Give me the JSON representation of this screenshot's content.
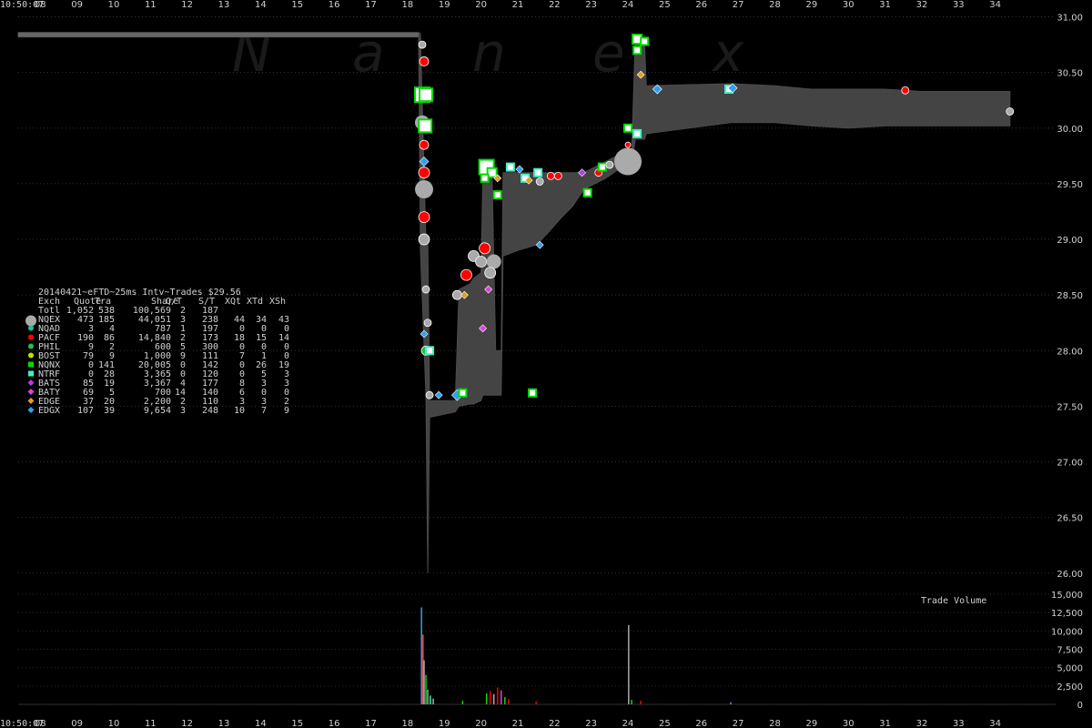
{
  "chart_data": {
    "type": "scatter",
    "watermark": [
      "N",
      "a",
      "n",
      "e",
      "x"
    ],
    "x_start_label": "10:50:07",
    "x_ticks": [
      "08",
      "09",
      "10",
      "11",
      "12",
      "13",
      "14",
      "15",
      "16",
      "17",
      "18",
      "19",
      "20",
      "21",
      "22",
      "23",
      "24",
      "25",
      "26",
      "27",
      "28",
      "29",
      "30",
      "31",
      "32",
      "33",
      "34"
    ],
    "x_range": [
      7.4,
      34.9
    ],
    "price_axis": {
      "range": [
        25.9,
        31.07
      ],
      "ticks": [
        "26.00",
        "26.50",
        "27.00",
        "27.50",
        "28.00",
        "28.50",
        "29.00",
        "29.50",
        "30.00",
        "30.50",
        "31.00"
      ]
    },
    "volume_axis": {
      "label": "Trade Volume",
      "range": [
        0,
        15000
      ],
      "ticks": [
        "0",
        "2,500",
        "5,000",
        "7,500",
        "10,000",
        "12,500",
        "15,000"
      ]
    },
    "table": {
      "title": "20140421~eFTD~25ms Intv~Trades $29.56",
      "columns": [
        "Exch",
        "Quote",
        "Tra",
        "Share",
        "Q/T",
        "S/T",
        "XQt",
        "XTd",
        "XSh"
      ],
      "total": [
        "Totl",
        "1,052",
        "538",
        "100,569",
        "2",
        "187",
        "",
        "",
        ""
      ],
      "rows": [
        {
          "cells": [
            "NQEX",
            "473",
            "185",
            "44,051",
            "3",
            "238",
            "44",
            "34",
            "43"
          ],
          "color": "#aaaaaa",
          "marker": "circle-big"
        },
        {
          "cells": [
            "NQAD",
            "3",
            "4",
            "787",
            "1",
            "197",
            "0",
            "0",
            "0"
          ],
          "color": "#20c0a0",
          "marker": "circle"
        },
        {
          "cells": [
            "PACF",
            "190",
            "86",
            "14,840",
            "2",
            "173",
            "18",
            "15",
            "14"
          ],
          "color": "#ff0000",
          "marker": "circle"
        },
        {
          "cells": [
            "PHIL",
            "9",
            "2",
            "600",
            "5",
            "300",
            "0",
            "0",
            "0"
          ],
          "color": "#20c040",
          "marker": "circle"
        },
        {
          "cells": [
            "BOST",
            "79",
            "9",
            "1,000",
            "9",
            "111",
            "7",
            "1",
            "0"
          ],
          "color": "#c0e000",
          "marker": "circle"
        },
        {
          "cells": [
            "NQNX",
            "0",
            "141",
            "20,005",
            "0",
            "142",
            "0",
            "26",
            "19"
          ],
          "color": "#00dd00",
          "marker": "square"
        },
        {
          "cells": [
            "NTRF",
            "0",
            "28",
            "3,365",
            "0",
            "120",
            "0",
            "5",
            "3"
          ],
          "color": "#40f0c0",
          "marker": "square"
        },
        {
          "cells": [
            "BATS",
            "85",
            "19",
            "3,367",
            "4",
            "177",
            "8",
            "3",
            "3"
          ],
          "color": "#b040e0",
          "marker": "diamond"
        },
        {
          "cells": [
            "BATY",
            "69",
            "5",
            "700",
            "14",
            "140",
            "6",
            "0",
            "0"
          ],
          "color": "#e040e0",
          "marker": "diamond"
        },
        {
          "cells": [
            "EDGE",
            "37",
            "20",
            "2,200",
            "2",
            "110",
            "3",
            "3",
            "2"
          ],
          "color": "#e0a020",
          "marker": "diamond"
        },
        {
          "cells": [
            "EDGX",
            "107",
            "39",
            "9,654",
            "3",
            "248",
            "10",
            "7",
            "9"
          ],
          "color": "#30a0f0",
          "marker": "diamond"
        }
      ]
    },
    "nbbo_band": [
      [
        7.4,
        30.86,
        30.82
      ],
      [
        18.3,
        30.86,
        30.82
      ],
      [
        18.35,
        30.85,
        28.9
      ],
      [
        18.5,
        29.0,
        27.6
      ],
      [
        18.55,
        29.0,
        26.0
      ],
      [
        18.6,
        27.55,
        27.4
      ],
      [
        19.3,
        27.55,
        27.45
      ],
      [
        19.4,
        28.55,
        27.5
      ],
      [
        19.7,
        28.6,
        27.52
      ],
      [
        19.8,
        28.65,
        27.52
      ],
      [
        20.0,
        28.7,
        27.55
      ],
      [
        20.05,
        29.55,
        27.6
      ],
      [
        20.3,
        29.6,
        27.6
      ],
      [
        20.4,
        28.0,
        27.6
      ],
      [
        20.55,
        28.0,
        27.6
      ],
      [
        20.6,
        29.6,
        28.85
      ],
      [
        21.0,
        29.6,
        28.9
      ],
      [
        21.5,
        29.6,
        28.95
      ],
      [
        21.8,
        29.6,
        29.05
      ],
      [
        22.2,
        29.6,
        29.2
      ],
      [
        22.5,
        29.6,
        29.3
      ],
      [
        22.8,
        29.6,
        29.45
      ],
      [
        23.1,
        29.65,
        29.5
      ],
      [
        23.4,
        29.7,
        29.55
      ],
      [
        23.7,
        29.75,
        29.62
      ],
      [
        24.1,
        29.78,
        29.66
      ],
      [
        24.2,
        30.8,
        29.9
      ],
      [
        24.45,
        30.8,
        29.9
      ],
      [
        24.5,
        30.38,
        29.95
      ],
      [
        26.8,
        30.4,
        30.05
      ],
      [
        28.0,
        30.38,
        30.05
      ],
      [
        29.0,
        30.35,
        30.02
      ],
      [
        30.0,
        30.35,
        30.0
      ],
      [
        31.0,
        30.35,
        30.02
      ],
      [
        32.0,
        30.33,
        30.02
      ],
      [
        33.0,
        30.33,
        30.02
      ],
      [
        34.4,
        30.33,
        30.02
      ]
    ],
    "trades": [
      {
        "x": 18.4,
        "y": 30.75,
        "ex": "NQEX",
        "s": 4
      },
      {
        "x": 18.45,
        "y": 30.6,
        "ex": "PACF",
        "s": 5
      },
      {
        "x": 18.4,
        "y": 30.3,
        "ex": "NQNX",
        "s": 8
      },
      {
        "x": 18.5,
        "y": 30.3,
        "ex": "NQNX",
        "s": 7
      },
      {
        "x": 18.4,
        "y": 30.05,
        "ex": "NQEX",
        "s": 8
      },
      {
        "x": 18.48,
        "y": 30.02,
        "ex": "NQNX",
        "s": 7
      },
      {
        "x": 18.45,
        "y": 29.85,
        "ex": "PACF",
        "s": 5
      },
      {
        "x": 18.45,
        "y": 29.7,
        "ex": "EDGX",
        "s": 5
      },
      {
        "x": 18.45,
        "y": 29.6,
        "ex": "PACF",
        "s": 6
      },
      {
        "x": 18.45,
        "y": 29.45,
        "ex": "NQEX",
        "s": 10
      },
      {
        "x": 18.45,
        "y": 29.2,
        "ex": "PACF",
        "s": 6
      },
      {
        "x": 18.45,
        "y": 29.0,
        "ex": "NQEX",
        "s": 6
      },
      {
        "x": 18.5,
        "y": 28.55,
        "ex": "NQEX",
        "s": 4
      },
      {
        "x": 18.55,
        "y": 28.25,
        "ex": "NQEX",
        "s": 4
      },
      {
        "x": 18.45,
        "y": 28.15,
        "ex": "EDGX",
        "s": 4
      },
      {
        "x": 18.5,
        "y": 28.0,
        "ex": "PHIL",
        "s": 5
      },
      {
        "x": 18.6,
        "y": 28.0,
        "ex": "NTRF",
        "s": 4
      },
      {
        "x": 18.6,
        "y": 27.6,
        "ex": "NQEX",
        "s": 4
      },
      {
        "x": 18.85,
        "y": 27.6,
        "ex": "EDGX",
        "s": 4
      },
      {
        "x": 19.35,
        "y": 27.6,
        "ex": "EDGX",
        "s": 6
      },
      {
        "x": 19.5,
        "y": 27.62,
        "ex": "NQNX",
        "s": 4
      },
      {
        "x": 19.35,
        "y": 28.5,
        "ex": "NQEX",
        "s": 5
      },
      {
        "x": 19.55,
        "y": 28.5,
        "ex": "EDGE",
        "s": 4
      },
      {
        "x": 19.6,
        "y": 28.68,
        "ex": "PACF",
        "s": 6
      },
      {
        "x": 19.8,
        "y": 28.85,
        "ex": "NQEX",
        "s": 6
      },
      {
        "x": 20.0,
        "y": 28.8,
        "ex": "NQEX",
        "s": 6
      },
      {
        "x": 20.1,
        "y": 28.92,
        "ex": "PACF",
        "s": 6
      },
      {
        "x": 20.35,
        "y": 28.8,
        "ex": "NQEX",
        "s": 8
      },
      {
        "x": 20.25,
        "y": 28.7,
        "ex": "NQEX",
        "s": 6
      },
      {
        "x": 20.05,
        "y": 28.2,
        "ex": "BATY",
        "s": 4
      },
      {
        "x": 20.15,
        "y": 29.65,
        "ex": "NQNX",
        "s": 8
      },
      {
        "x": 20.3,
        "y": 29.6,
        "ex": "NQNX",
        "s": 5
      },
      {
        "x": 20.45,
        "y": 29.55,
        "ex": "EDGE",
        "s": 4
      },
      {
        "x": 20.1,
        "y": 29.55,
        "ex": "NQNX",
        "s": 4
      },
      {
        "x": 20.8,
        "y": 29.65,
        "ex": "NTRF",
        "s": 4
      },
      {
        "x": 21.05,
        "y": 29.63,
        "ex": "EDGX",
        "s": 4
      },
      {
        "x": 21.2,
        "y": 29.55,
        "ex": "NTRF",
        "s": 4
      },
      {
        "x": 21.55,
        "y": 29.6,
        "ex": "NTRF",
        "s": 4
      },
      {
        "x": 21.3,
        "y": 29.53,
        "ex": "EDGE",
        "s": 4
      },
      {
        "x": 21.6,
        "y": 29.52,
        "ex": "NQEX",
        "s": 4
      },
      {
        "x": 21.9,
        "y": 29.57,
        "ex": "PACF",
        "s": 4
      },
      {
        "x": 22.1,
        "y": 29.57,
        "ex": "PACF",
        "s": 4
      },
      {
        "x": 22.75,
        "y": 29.6,
        "ex": "BATS",
        "s": 4
      },
      {
        "x": 23.2,
        "y": 29.6,
        "ex": "PACF",
        "s": 4
      },
      {
        "x": 23.3,
        "y": 29.65,
        "ex": "NQNX",
        "s": 4
      },
      {
        "x": 23.5,
        "y": 29.67,
        "ex": "NQEX",
        "s": 4
      },
      {
        "x": 22.9,
        "y": 29.42,
        "ex": "NQNX",
        "s": 4
      },
      {
        "x": 20.45,
        "y": 29.4,
        "ex": "NQNX",
        "s": 4
      },
      {
        "x": 21.4,
        "y": 27.62,
        "ex": "NQNX",
        "s": 4
      },
      {
        "x": 21.6,
        "y": 28.95,
        "ex": "EDGX",
        "s": 4
      },
      {
        "x": 20.2,
        "y": 28.55,
        "ex": "BATY",
        "s": 4
      },
      {
        "x": 24.0,
        "y": 29.7,
        "ex": "NQEX",
        "s": 15
      },
      {
        "x": 24.0,
        "y": 30.0,
        "ex": "NQNX",
        "s": 4
      },
      {
        "x": 24.25,
        "y": 29.95,
        "ex": "NTRF",
        "s": 4
      },
      {
        "x": 24.0,
        "y": 29.85,
        "ex": "PACF",
        "s": 3
      },
      {
        "x": 24.25,
        "y": 30.8,
        "ex": "NQNX",
        "s": 5
      },
      {
        "x": 24.45,
        "y": 30.78,
        "ex": "NQNX",
        "s": 4
      },
      {
        "x": 24.25,
        "y": 30.7,
        "ex": "NQNX",
        "s": 4
      },
      {
        "x": 24.35,
        "y": 30.48,
        "ex": "EDGE",
        "s": 4
      },
      {
        "x": 24.8,
        "y": 30.35,
        "ex": "EDGX",
        "s": 5
      },
      {
        "x": 26.75,
        "y": 30.35,
        "ex": "NTRF",
        "s": 4
      },
      {
        "x": 26.85,
        "y": 30.36,
        "ex": "EDGX",
        "s": 5
      },
      {
        "x": 31.55,
        "y": 30.34,
        "ex": "PACF",
        "s": 4
      },
      {
        "x": 34.4,
        "y": 30.15,
        "ex": "NQEX",
        "s": 4
      }
    ],
    "volume_spikes": [
      {
        "x": 18.38,
        "v": 13200,
        "c": "#30a0f0"
      },
      {
        "x": 18.42,
        "v": 9500,
        "c": "#ff4040"
      },
      {
        "x": 18.45,
        "v": 6000,
        "c": "#aaaaaa"
      },
      {
        "x": 18.5,
        "v": 4000,
        "c": "#00dd00"
      },
      {
        "x": 18.55,
        "v": 2000,
        "c": "#aaaaaa"
      },
      {
        "x": 18.62,
        "v": 1200,
        "c": "#40f0c0"
      },
      {
        "x": 18.7,
        "v": 800,
        "c": "#aaaaaa"
      },
      {
        "x": 20.15,
        "v": 1500,
        "c": "#00dd00"
      },
      {
        "x": 20.25,
        "v": 1800,
        "c": "#ff0000"
      },
      {
        "x": 20.35,
        "v": 1400,
        "c": "#aaaaaa"
      },
      {
        "x": 20.45,
        "v": 2300,
        "c": "#ff0000"
      },
      {
        "x": 20.55,
        "v": 1900,
        "c": "#e040e0"
      },
      {
        "x": 20.65,
        "v": 1000,
        "c": "#00dd00"
      },
      {
        "x": 20.75,
        "v": 700,
        "c": "#ff0000"
      },
      {
        "x": 24.02,
        "v": 10800,
        "c": "#aaaaaa"
      },
      {
        "x": 24.1,
        "v": 600,
        "c": "#00dd00"
      },
      {
        "x": 24.35,
        "v": 500,
        "c": "#ff0000"
      },
      {
        "x": 26.8,
        "v": 300,
        "c": "#30a0f0"
      },
      {
        "x": 19.5,
        "v": 500,
        "c": "#00dd00"
      },
      {
        "x": 21.5,
        "v": 400,
        "c": "#ff0000"
      }
    ]
  }
}
